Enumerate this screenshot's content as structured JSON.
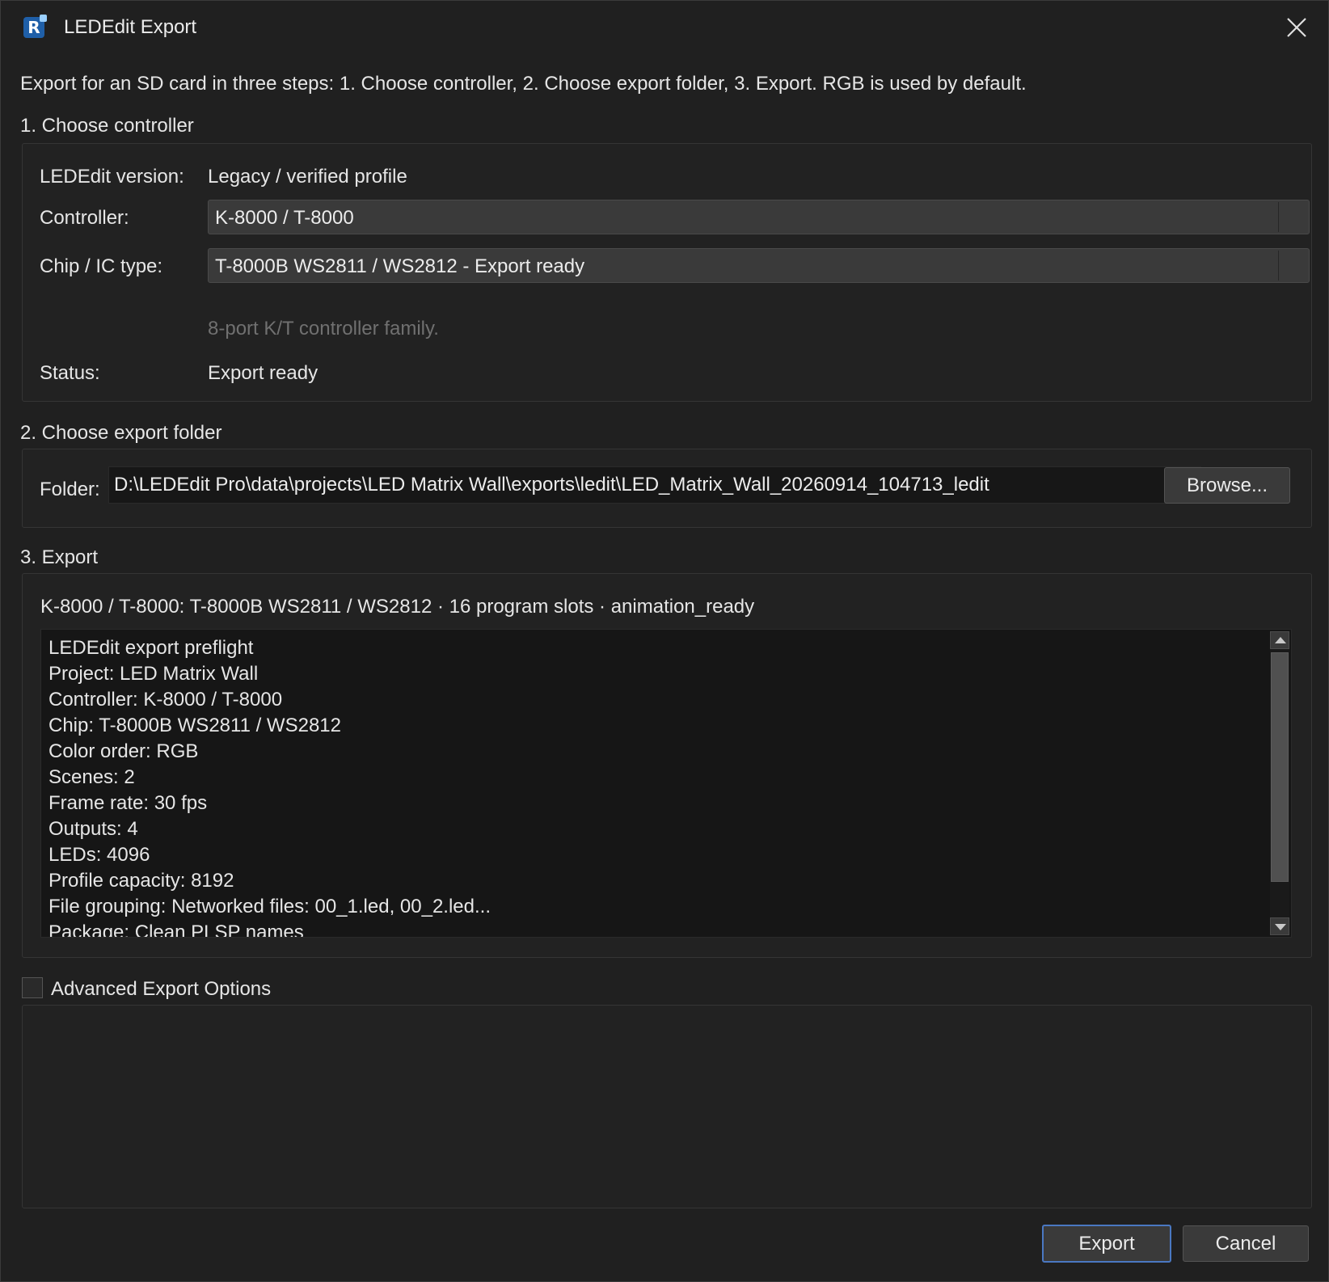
{
  "window": {
    "title": "LEDEdit Export",
    "icon": "app-logo-icon"
  },
  "intro": "Export for an SD card in three steps: 1. Choose controller, 2. Choose export folder, 3. Export. RGB is used by default.",
  "step1": {
    "heading": "1. Choose controller",
    "version_label": "LEDEdit version:",
    "version_value": "Legacy / verified profile",
    "controller_label": "Controller:",
    "controller_value": "K-8000 / T-8000",
    "chip_label": "Chip / IC type:",
    "chip_value": "T-8000B WS2811 / WS2812 - Export ready",
    "hint": "8-port K/T controller family.",
    "status_label": "Status:",
    "status_value": "Export ready"
  },
  "step2": {
    "heading": "2. Choose export folder",
    "folder_label": "Folder:",
    "folder_value": "D:\\LEDEdit Pro\\data\\projects\\LED Matrix Wall\\exports\\ledit\\LED_Matrix_Wall_20260914_104713_ledit",
    "browse_label": "Browse..."
  },
  "step3": {
    "heading": "3. Export",
    "summary": "K-8000 / T-8000: T-8000B WS2811 / WS2812 · 16 program slots · animation_ready",
    "log_lines": [
      "LEDEdit export preflight",
      "Project: LED Matrix Wall",
      "Controller: K-8000 / T-8000",
      "Chip: T-8000B WS2811 / WS2812",
      "Color order: RGB",
      "Scenes: 2",
      "Frame rate: 30 fps",
      "Outputs: 4",
      "LEDs: 4096",
      "Profile capacity: 8192",
      "File grouping: Networked files: 00_1.led, 00_2.led...",
      "Package: Clean PLSP names"
    ]
  },
  "advanced": {
    "label": "Advanced Export Options",
    "checked": false
  },
  "buttons": {
    "export_label": "Export",
    "cancel_label": "Cancel"
  },
  "colors": {
    "background": "#202020",
    "accent_border": "#4a78c2",
    "hint_text": "#707070"
  }
}
